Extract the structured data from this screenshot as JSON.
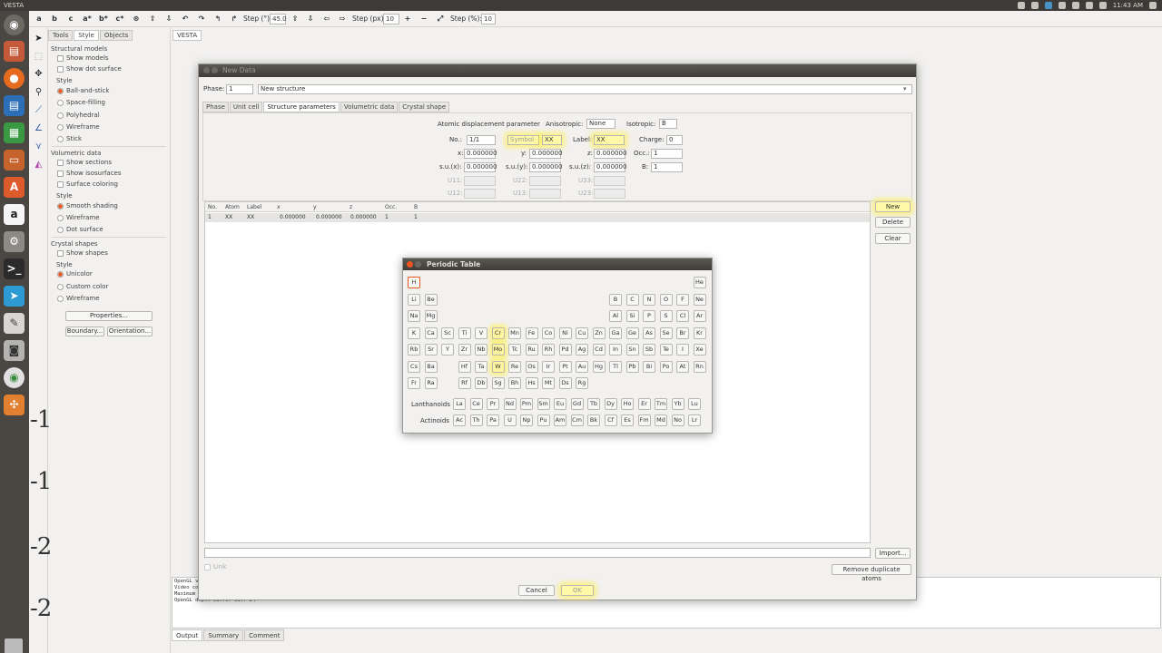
{
  "topbar": {
    "app_title": "VESTA",
    "clock": "11:43 AM"
  },
  "toolbar": {
    "buttons": [
      "a",
      "b",
      "c",
      "a*",
      "b*",
      "c*"
    ],
    "step_deg_label": "Step (°):",
    "step_deg_value": "45.0",
    "step_px_label": "Step (px):",
    "step_px_value": "10",
    "step_pct_label": "Step (%):",
    "step_pct_value": "10"
  },
  "panel": {
    "tabs": [
      "Tools",
      "Style",
      "Objects"
    ],
    "structural_models": "Structural models",
    "show_models": "Show models",
    "show_dot_surface": "Show dot surface",
    "style": "Style",
    "ball_and_stick": "Ball-and-stick",
    "space_filling": "Space-filling",
    "polyhedral": "Polyhedral",
    "wireframe": "Wireframe",
    "stick": "Stick",
    "volumetric_data": "Volumetric data",
    "show_sections": "Show sections",
    "show_isosurfaces": "Show isosurfaces",
    "surface_coloring": "Surface coloring",
    "smooth_shading": "Smooth shading",
    "dot_surface": "Dot surface",
    "crystal_shapes": "Crystal shapes",
    "show_shapes": "Show shapes",
    "unicolor": "Unicolor",
    "custom_color": "Custom color",
    "properties": "Properties...",
    "boundary": "Boundary...",
    "orientation": "Orientation..."
  },
  "document": {
    "tab": "VESTA",
    "bg_numbers": [
      "-1",
      "-1",
      "-2",
      "-2"
    ]
  },
  "console": {
    "lines": [
      "OpenGL v",
      "Video co",
      "Maximum",
      "OpenGL depth buffer bit: 24"
    ],
    "tabs": [
      "Output",
      "Summary",
      "Comment"
    ]
  },
  "dialog": {
    "title": "New Data",
    "phase_label": "Phase:",
    "phase_value": "1",
    "structure_name": "New structure",
    "tabs": [
      "Phase",
      "Unit cell",
      "Structure parameters",
      "Volumetric data",
      "Crystal shape"
    ],
    "adp_label": "Atomic displacement parameter",
    "anisotropic_label": "Anisotropic:",
    "anisotropic_value": "None",
    "isotropic_label": "Isotropic:",
    "isotropic_value": "B",
    "no_label": "No.:",
    "no_value": "1/1",
    "symbol_button": "Symbol",
    "symbol_value": "XX",
    "label_label": "Label:",
    "label_value": "XX",
    "charge_label": "Charge:",
    "charge_value": "0",
    "x_label": "x:",
    "x_value": "0.000000",
    "y_label": "y:",
    "y_value": "0.000000",
    "z_label": "z:",
    "z_value": "0.000000",
    "occ_label": "Occ.:",
    "occ_value": "1",
    "sux_label": "s.u.(x):",
    "sux_value": "0.000000",
    "suy_label": "s.u.(y):",
    "suy_value": "0.000000",
    "suz_label": "s.u.(z):",
    "suz_value": "0.000000",
    "b_label": "B:",
    "b_value": "1",
    "u11": "U11:",
    "u22": "U22:",
    "u33": "U33:",
    "u12": "U12:",
    "u13": "U13:",
    "u23": "U23:",
    "columns": [
      "No.",
      "Atom",
      "Label",
      "x",
      "y",
      "z",
      "Occ.",
      "B"
    ],
    "rows": [
      [
        "1",
        "XX",
        "XX",
        "0.000000",
        "0.000000",
        "0.000000",
        "1",
        "1"
      ]
    ],
    "new_button": "New",
    "delete_button": "Delete",
    "clear_button": "Clear",
    "import_button": "Import...",
    "link_label": "Link",
    "remove_duplicates_button": "Remove duplicate atoms",
    "cancel_button": "Cancel",
    "ok_button": "OK"
  },
  "periodic_table": {
    "title": "Periodic Table",
    "lanthanoids_label": "Lanthanoids",
    "actinoids_label": "Actinoids",
    "rows": [
      [
        "H",
        "",
        "",
        "",
        "",
        "",
        "",
        "",
        "",
        "",
        "",
        "",
        "",
        "",
        "",
        "",
        "",
        "He"
      ],
      [
        "Li",
        "Be",
        "",
        "",
        "",
        "",
        "",
        "",
        "",
        "",
        "",
        "",
        "B",
        "C",
        "N",
        "O",
        "F",
        "Ne"
      ],
      [
        "Na",
        "Mg",
        "",
        "",
        "",
        "",
        "",
        "",
        "",
        "",
        "",
        "",
        "Al",
        "Si",
        "P",
        "S",
        "Cl",
        "Ar"
      ],
      [
        "K",
        "Ca",
        "Sc",
        "Ti",
        "V",
        "Cr",
        "Mn",
        "Fe",
        "Co",
        "Ni",
        "Cu",
        "Zn",
        "Ga",
        "Ge",
        "As",
        "Se",
        "Br",
        "Kr"
      ],
      [
        "Rb",
        "Sr",
        "Y",
        "Zr",
        "Nb",
        "Mo",
        "Tc",
        "Ru",
        "Rh",
        "Pd",
        "Ag",
        "Cd",
        "In",
        "Sn",
        "Sb",
        "Te",
        "I",
        "Xe"
      ],
      [
        "Cs",
        "Ba",
        "",
        "Hf",
        "Ta",
        "W",
        "Re",
        "Os",
        "Ir",
        "Pt",
        "Au",
        "Hg",
        "Tl",
        "Pb",
        "Bi",
        "Po",
        "At",
        "Rn"
      ],
      [
        "Fr",
        "Ra",
        "",
        "Rf",
        "Db",
        "Sg",
        "Bh",
        "Hs",
        "Mt",
        "Ds",
        "Rg",
        "",
        "",
        "",
        "",
        "",
        "",
        ""
      ]
    ],
    "lanthanoids": [
      "La",
      "Ce",
      "Pr",
      "Nd",
      "Pm",
      "Sm",
      "Eu",
      "Gd",
      "Tb",
      "Dy",
      "Ho",
      "Er",
      "Tm",
      "Yb",
      "Lu"
    ],
    "actinoids": [
      "Ac",
      "Th",
      "Pa",
      "U",
      "Np",
      "Pu",
      "Am",
      "Cm",
      "Bk",
      "Cf",
      "Es",
      "Fm",
      "Md",
      "No",
      "Lr"
    ],
    "selected": "H",
    "highlighted": [
      "Cr",
      "Mo",
      "W"
    ]
  },
  "colors": {
    "accent": "#e9541f",
    "highlight": "#fff4a0",
    "titlebar": "#3f3d38"
  }
}
